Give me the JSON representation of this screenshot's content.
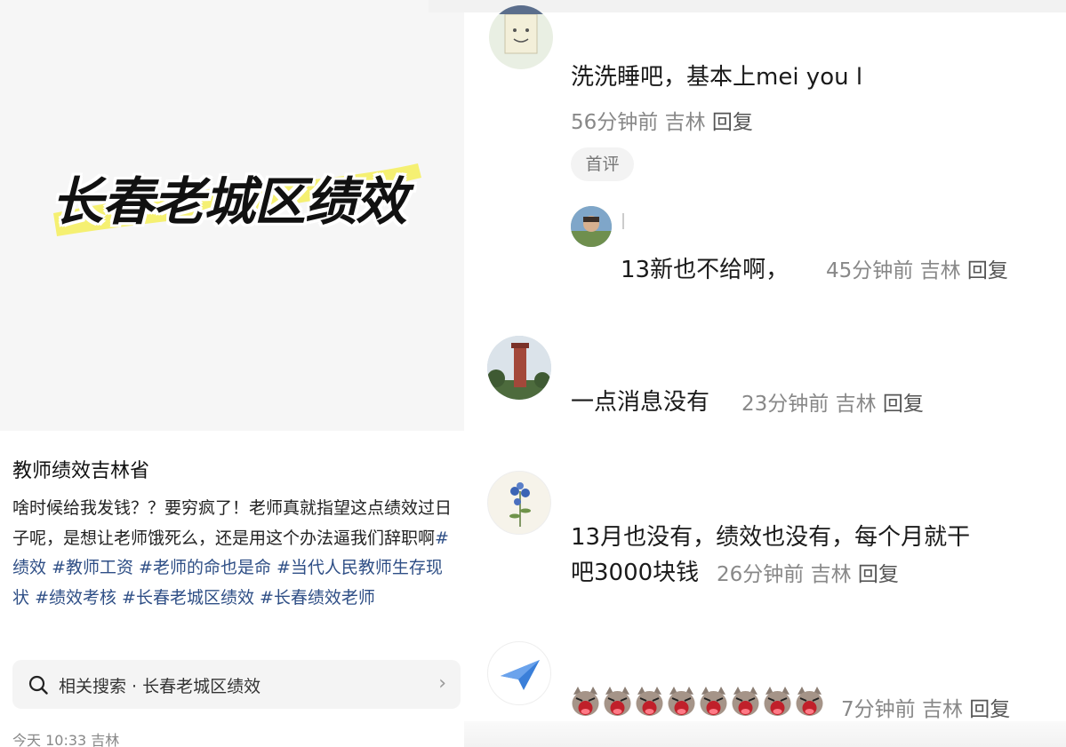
{
  "post": {
    "cover_title": "长春老城区绩效",
    "title": "教师绩效吉林省",
    "body_text": "啥时候给我发钱？？要穷疯了！老师真就指望这点绩效过日子呢，是想让老师饿死么，还是用这个办法逼我们辞职啊",
    "tags": [
      "#绩效",
      "#教师工资",
      "#老师的命也是命",
      "#当代人民教师生存现状",
      "#绩效考核",
      "#长春老城区绩效",
      "#长春绩效老师"
    ],
    "related_search": "相关搜索 · 长春老城区绩效",
    "meta": "今天 10:33 吉林",
    "highlight_color": "#f5ef5a",
    "tag_color": "#2f4f86"
  },
  "comments": [
    {
      "text": "洗洗睡吧，基本上mei you l",
      "time": "56分钟前",
      "location": "吉林",
      "reply": "回复",
      "badge": "首评",
      "avatar_icon": "paper-bag-face-avatar"
    },
    {
      "text": "13新也不给啊，",
      "time": "45分钟前",
      "location": "吉林",
      "reply": "回复",
      "avatar_icon": "person-photo-avatar"
    },
    {
      "text": "一点消息没有",
      "time": "23分钟前",
      "location": "吉林",
      "reply": "回复",
      "avatar_icon": "tower-photo-avatar"
    },
    {
      "text_line1": "13月也没有，绩效也没有，每个月就干",
      "text_line2": "吧3000块钱",
      "time": "26分钟前",
      "location": "吉林",
      "reply": "回复",
      "avatar_icon": "flower-drawing-avatar"
    },
    {
      "emoji_count": 8,
      "emoji_icon": "crying-cat-emoji",
      "time": "7分钟前",
      "location": "吉林",
      "reply": "回复",
      "avatar_icon": "paper-plane-avatar"
    }
  ]
}
